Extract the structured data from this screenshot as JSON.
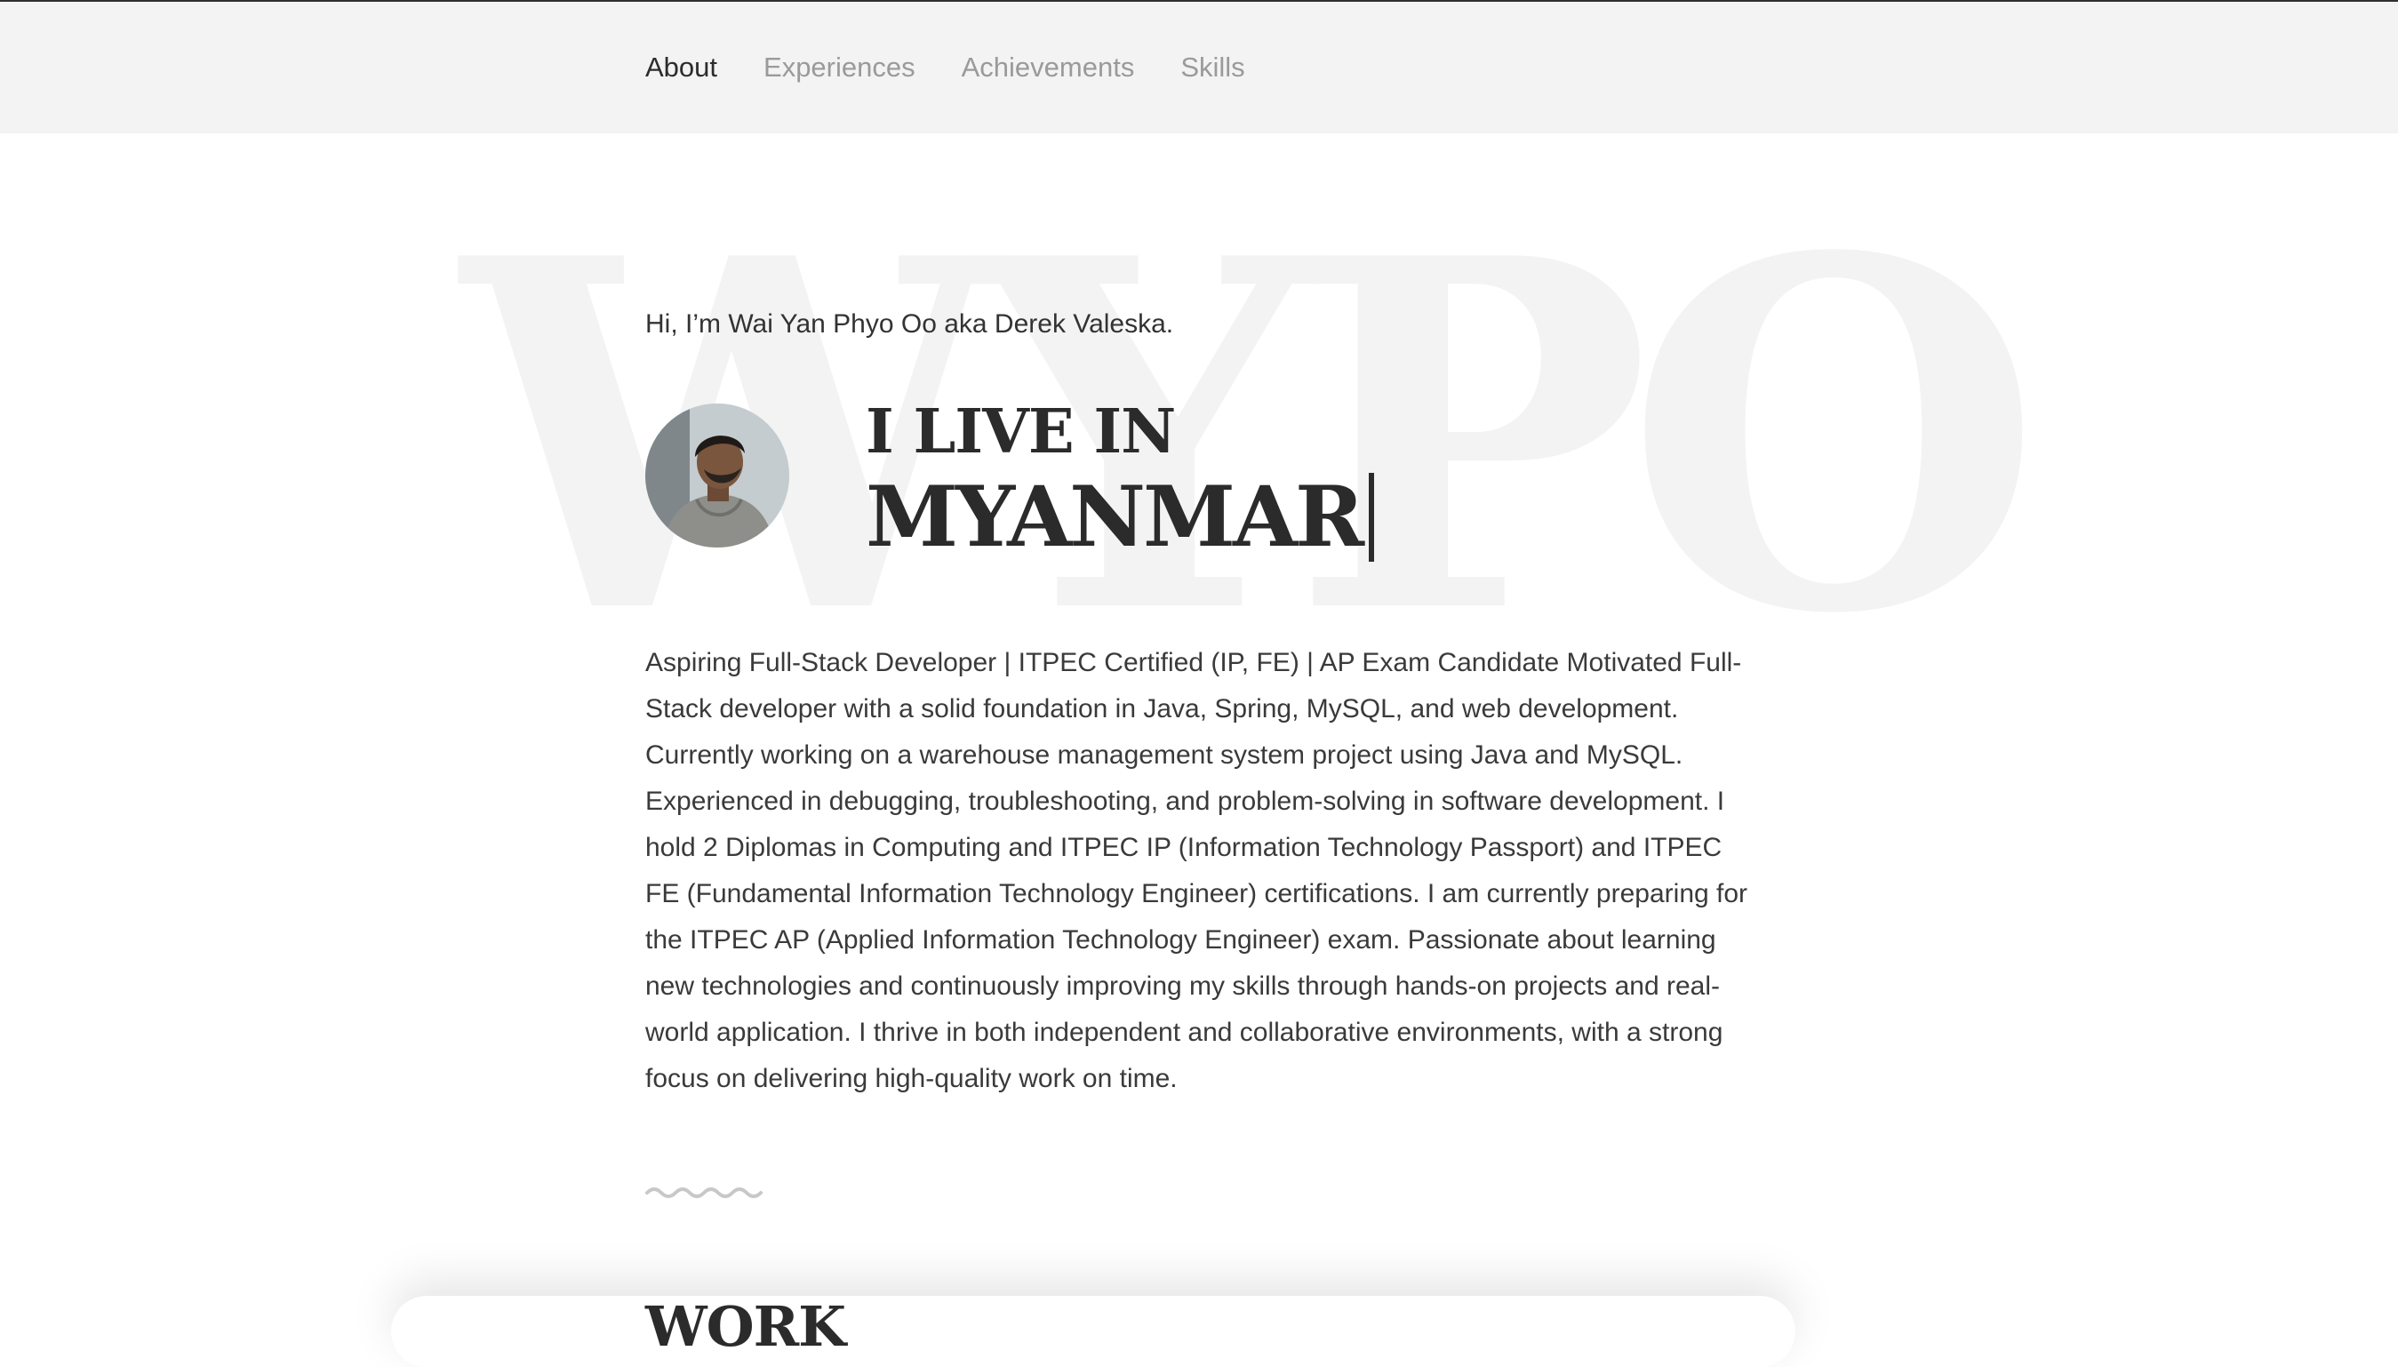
{
  "nav": {
    "items": [
      {
        "label": "About",
        "active": true
      },
      {
        "label": "Experiences",
        "active": false
      },
      {
        "label": "Achievements",
        "active": false
      },
      {
        "label": "Skills",
        "active": false
      }
    ]
  },
  "hero": {
    "background_initials": "WYPO",
    "greeting": "Hi, I’m Wai Yan Phyo Oo aka Derek Valeska.",
    "avatar_icon": "profile-photo",
    "headline_line1": "I LIVE IN",
    "headline_line2": "MYANMAR"
  },
  "bio": "Aspiring Full-Stack Developer | ITPEC Certified (IP, FE) | AP Exam Candidate Motivated Full-Stack developer with a solid foundation in Java, Spring, MySQL, and web development. Currently working on a warehouse management system project using Java and MySQL. Experienced in debugging, troubleshooting, and problem-solving in software development. I hold 2 Diplomas in Computing and ITPEC IP (Information Technology Passport) and ITPEC FE (Fundamental Information Technology Engineer) certifications. I am currently preparing for the ITPEC AP (Applied Information Technology Engineer) exam. Passionate about learning new technologies and continuously improving my skills through hands-on projects and real-world application. I thrive in both independent and collaborative environments, with a strong focus on delivering high-quality work on time.",
  "section": {
    "work_title": "WORK"
  },
  "colors": {
    "nav_bg": "#f3f3f3",
    "nav_active": "#2c2c2c",
    "nav_inactive": "#9a9a9a",
    "watermark": "#f3f3f3",
    "text": "#333333"
  }
}
